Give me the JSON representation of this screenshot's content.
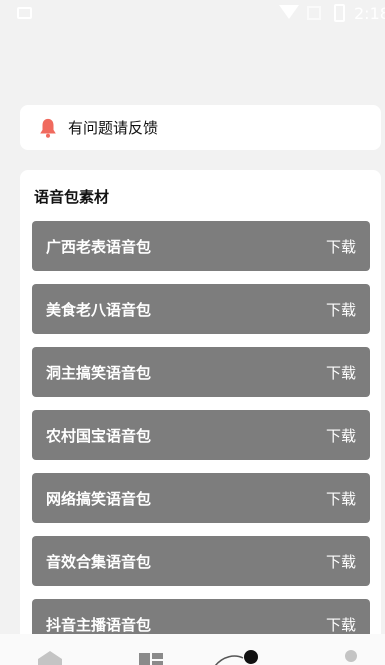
{
  "status_bar": {
    "time": "2:18"
  },
  "feedback": {
    "text": "有问题请反馈",
    "icon": "bell-icon",
    "icon_color": "#f06a5e"
  },
  "section": {
    "title": "语音包素材"
  },
  "packs": [
    {
      "name": "广西老表语音包",
      "action": "下载"
    },
    {
      "name": "美食老八语音包",
      "action": "下载"
    },
    {
      "name": "洞主搞笑语音包",
      "action": "下载"
    },
    {
      "name": "农村国宝语音包",
      "action": "下载"
    },
    {
      "name": "网络搞笑语音包",
      "action": "下载"
    },
    {
      "name": "音效合集语音包",
      "action": "下载"
    },
    {
      "name": "抖音主播语音包",
      "action": "下载"
    }
  ],
  "bottom_nav": {
    "items": [
      {
        "icon": "home-icon"
      },
      {
        "icon": "grid-icon"
      },
      {
        "icon": "center-icon"
      },
      {
        "icon": "profile-icon"
      }
    ]
  },
  "colors": {
    "pack_bg": "#7d7d7d",
    "page_bg": "#f2f2f2",
    "card_bg": "#ffffff"
  }
}
